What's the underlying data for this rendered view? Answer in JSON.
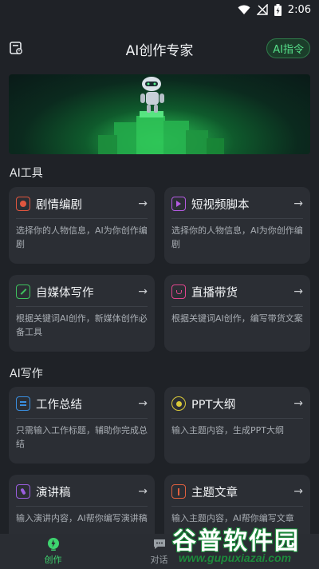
{
  "status_bar": {
    "time": "2:06"
  },
  "header": {
    "title": "AI创作专家",
    "ai_command_label": "AI指令"
  },
  "sections": [
    {
      "title": "AI工具",
      "cards": [
        {
          "name": "剧情编剧",
          "desc": "选择你的人物信息，AI为你创作编剧",
          "icon": "drama-icon",
          "color": "#e0563f"
        },
        {
          "name": "短视频脚本",
          "desc": "选择你的人物信息，AI为你创作编剧",
          "icon": "video-icon",
          "color": "#b35be0"
        },
        {
          "name": "自媒体写作",
          "desc": "根据关键词AI创作，新媒体创作必备工具",
          "icon": "pencil-icon",
          "color": "#3fc35e"
        },
        {
          "name": "直播带货",
          "desc": "根据关键词AI创作，编写带货文案",
          "icon": "shopping-bag-icon",
          "color": "#e0468c"
        }
      ]
    },
    {
      "title": "AI写作",
      "cards": [
        {
          "name": "工作总结",
          "desc": "只需输入工作标题，辅助你完成总结",
          "icon": "document-icon",
          "color": "#3a8fe0"
        },
        {
          "name": "PPT大纲",
          "desc": "输入主题内容，生成PPT大纲",
          "icon": "ppt-icon",
          "color": "#d9c93a"
        },
        {
          "name": "演讲稿",
          "desc": "输入演讲内容，AI帮你编写演讲稿",
          "icon": "microphone-icon",
          "color": "#9b5ee0"
        },
        {
          "name": "主题文章",
          "desc": "输入主题内容，AI帮你编写文章",
          "icon": "book-icon",
          "color": "#e0603f"
        }
      ]
    }
  ],
  "bottom_nav": [
    {
      "label": "创作",
      "icon": "create-icon",
      "active": true
    },
    {
      "label": "对话",
      "icon": "chat-icon",
      "active": false
    },
    {
      "label": "",
      "icon": "profile-icon",
      "active": false
    }
  ],
  "watermark": {
    "title": "谷普软件园",
    "url": "www.gupuxiazai.com"
  },
  "colors": {
    "accent": "#3ed46f",
    "background": "#1f2227",
    "card": "#2b2e34"
  }
}
